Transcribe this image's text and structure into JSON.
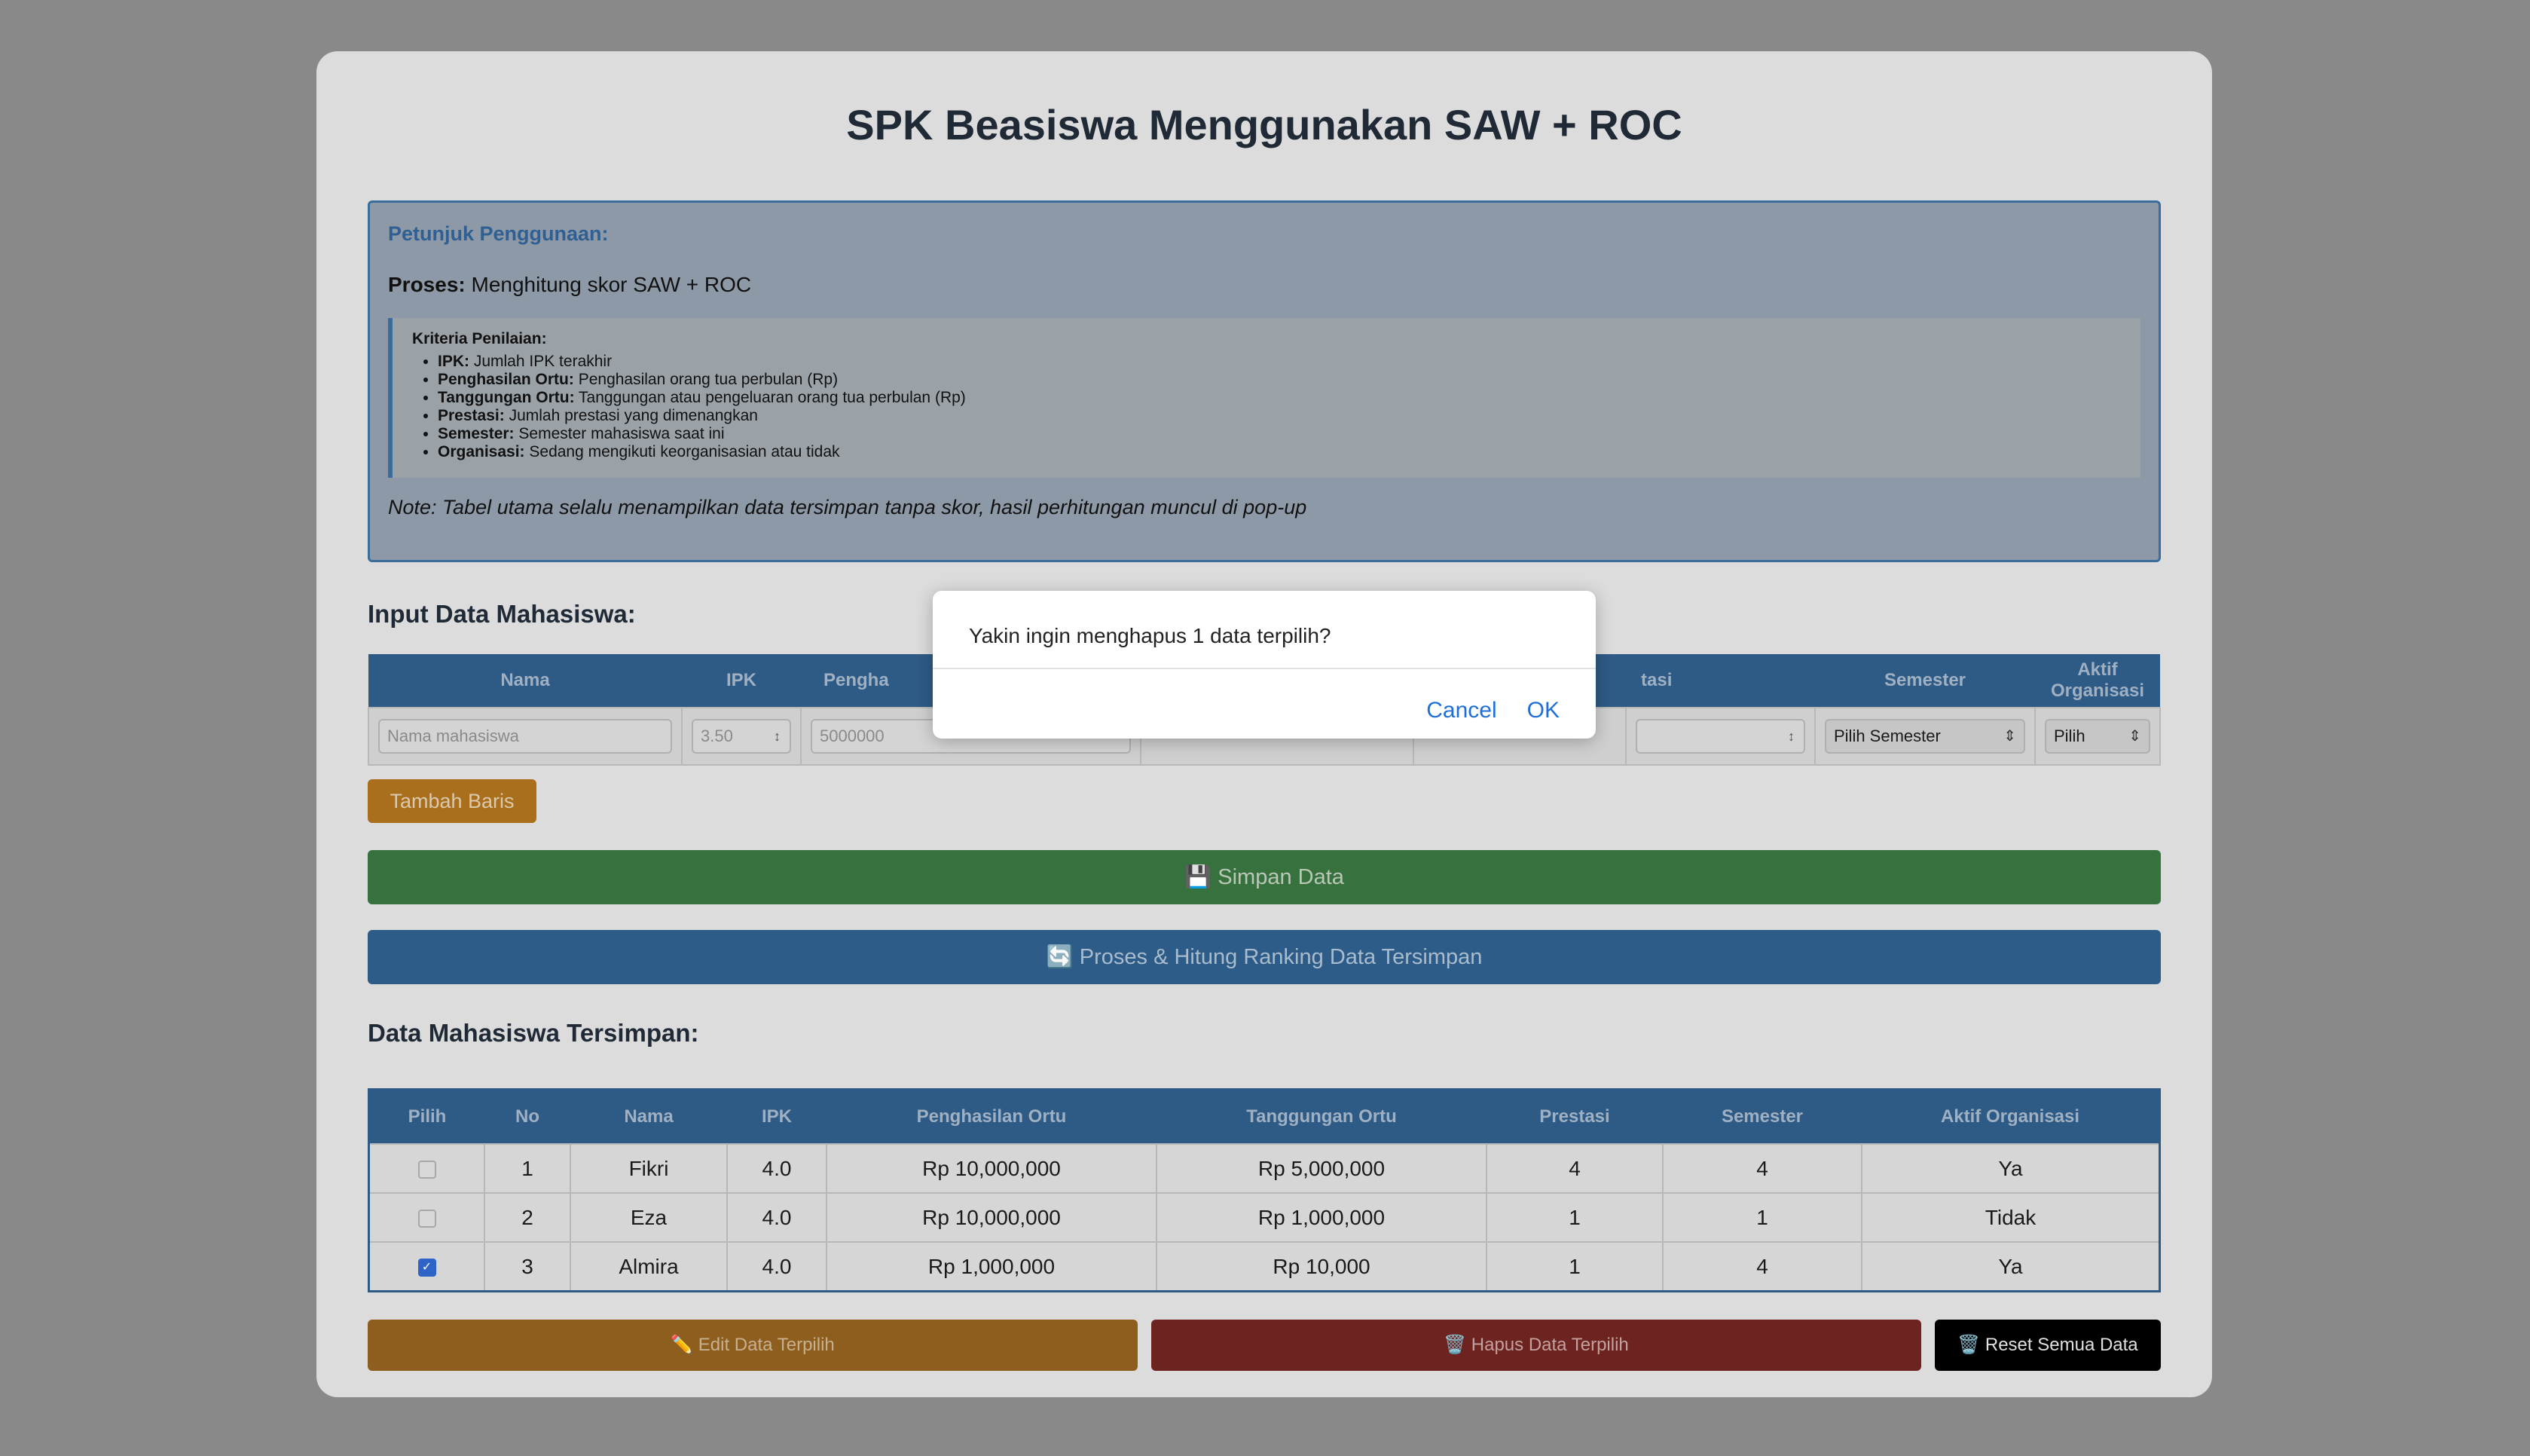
{
  "title": "SPK Beasiswa Menggunakan SAW + ROC",
  "info": {
    "heading": "Petunjuk Penggunaan:",
    "proses_label": "Proses:",
    "proses_text": "Menghitung skor SAW + ROC",
    "criteria_heading": "Kriteria Penilaian:",
    "criteria": [
      {
        "name": "IPK:",
        "desc": "Jumlah IPK terakhir"
      },
      {
        "name": "Penghasilan Ortu:",
        "desc": "Penghasilan orang tua perbulan (Rp)"
      },
      {
        "name": "Tanggungan Ortu:",
        "desc": "Tanggungan atau pengeluaran orang tua perbulan (Rp)"
      },
      {
        "name": "Prestasi:",
        "desc": "Jumlah prestasi yang dimenangkan"
      },
      {
        "name": "Semester:",
        "desc": "Semester mahasiswa saat ini"
      },
      {
        "name": "Organisasi:",
        "desc": "Sedang mengikuti keorganisasian atau tidak"
      }
    ],
    "note": "Note: Tabel utama selalu menampilkan data tersimpan tanpa skor, hasil perhitungan muncul di pop-up"
  },
  "input_section": {
    "heading": "Input Data Mahasiswa:",
    "headers": [
      "Nama",
      "IPK",
      "Pengha",
      "",
      "",
      "tasi",
      "Semester",
      "Aktif Organisasi"
    ],
    "nama_placeholder": "Nama mahasiswa",
    "ipk_placeholder": "3.50",
    "penghasilan_placeholder": "5000000",
    "semester_select": "Pilih Semester",
    "organisasi_select": "Pilih",
    "add_row_button": "Tambah Baris"
  },
  "save_button": "💾 Simpan Data",
  "process_button": "🔄 Proses & Hitung Ranking Data Tersimpan",
  "saved_section": {
    "heading": "Data Mahasiswa Tersimpan:",
    "headers": [
      "Pilih",
      "No",
      "Nama",
      "IPK",
      "Penghasilan Ortu",
      "Tanggungan Ortu",
      "Prestasi",
      "Semester",
      "Aktif Organisasi"
    ],
    "rows": [
      {
        "checked": false,
        "no": "1",
        "nama": "Fikri",
        "ipk": "4.0",
        "penghasilan": "Rp 10,000,000",
        "tanggungan": "Rp 5,000,000",
        "prestasi": "4",
        "semester": "4",
        "organisasi": "Ya"
      },
      {
        "checked": false,
        "no": "2",
        "nama": "Eza",
        "ipk": "4.0",
        "penghasilan": "Rp 10,000,000",
        "tanggungan": "Rp 1,000,000",
        "prestasi": "1",
        "semester": "1",
        "organisasi": "Tidak"
      },
      {
        "checked": true,
        "no": "3",
        "nama": "Almira",
        "ipk": "4.0",
        "penghasilan": "Rp 1,000,000",
        "tanggungan": "Rp 10,000",
        "prestasi": "1",
        "semester": "4",
        "organisasi": "Ya"
      }
    ]
  },
  "actions": {
    "edit": "✏️ Edit Data Terpilih",
    "delete": "🗑️ Hapus Data Terpilih",
    "reset": "🗑️ Reset Semua Data"
  },
  "dialog": {
    "message": "Yakin ingin menghapus 1 data terpilih?",
    "cancel": "Cancel",
    "ok": "OK"
  }
}
